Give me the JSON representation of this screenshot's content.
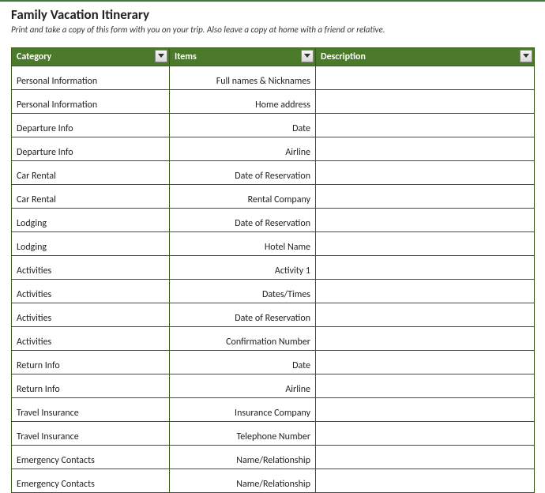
{
  "title": "Family Vacation Itinerary",
  "subtitle": "Print and take a copy of this form with you on your trip. Also leave a copy at home with a friend or relative.",
  "headers": {
    "category": "Category",
    "items": "Items",
    "description": "Description"
  },
  "rows": [
    {
      "category": "Personal Information",
      "items": "Full names & Nicknames",
      "description": ""
    },
    {
      "category": "Personal Information",
      "items": "Home address",
      "description": ""
    },
    {
      "category": "Departure Info",
      "items": "Date",
      "description": ""
    },
    {
      "category": "Departure Info",
      "items": "Airline",
      "description": ""
    },
    {
      "category": "Car Rental",
      "items": "Date of Reservation",
      "description": ""
    },
    {
      "category": "Car Rental",
      "items": "Rental Company",
      "description": ""
    },
    {
      "category": "Lodging",
      "items": "Date of Reservation",
      "description": ""
    },
    {
      "category": "Lodging",
      "items": "Hotel Name",
      "description": ""
    },
    {
      "category": "Activities",
      "items": "Activity 1",
      "description": ""
    },
    {
      "category": "Activities",
      "items": "Dates/Times",
      "description": ""
    },
    {
      "category": "Activities",
      "items": "Date of Reservation",
      "description": ""
    },
    {
      "category": "Activities",
      "items": "Confirmation Number",
      "description": ""
    },
    {
      "category": "Return Info",
      "items": "Date",
      "description": ""
    },
    {
      "category": "Return Info",
      "items": "Airline",
      "description": ""
    },
    {
      "category": "Travel Insurance",
      "items": "Insurance Company",
      "description": ""
    },
    {
      "category": "Travel Insurance",
      "items": "Telephone Number",
      "description": ""
    },
    {
      "category": "Emergency Contacts",
      "items": "Name/Relationship",
      "description": ""
    },
    {
      "category": "Emergency Contacts",
      "items": "Name/Relationship",
      "description": ""
    }
  ]
}
